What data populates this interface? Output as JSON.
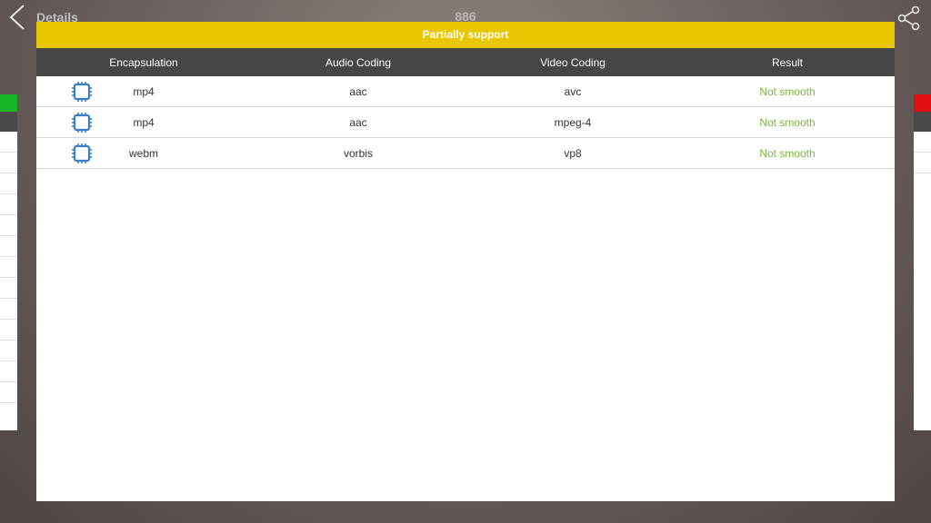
{
  "app": {
    "title": "Details",
    "center_title": "886"
  },
  "icons": {
    "back": "chevron-left-icon",
    "share": "share-icon",
    "row_icon": "chip-icon"
  },
  "dialog": {
    "header": "Partially support",
    "columns": [
      "Encapsulation",
      "Audio Coding",
      "Video Coding",
      "Result"
    ],
    "rows": [
      {
        "encapsulation": "mp4",
        "audio": "aac",
        "video": "avc",
        "result": "Not smooth"
      },
      {
        "encapsulation": "mp4",
        "audio": "aac",
        "video": "mpeg-4",
        "result": "Not smooth"
      },
      {
        "encapsulation": "webm",
        "audio": "vorbis",
        "video": "vp8",
        "result": "Not smooth"
      }
    ]
  },
  "colors": {
    "header_yellow": "#e8c600",
    "column_header": "#464646",
    "result_green": "#7cb342",
    "chip_blue": "#3a7ec8"
  }
}
